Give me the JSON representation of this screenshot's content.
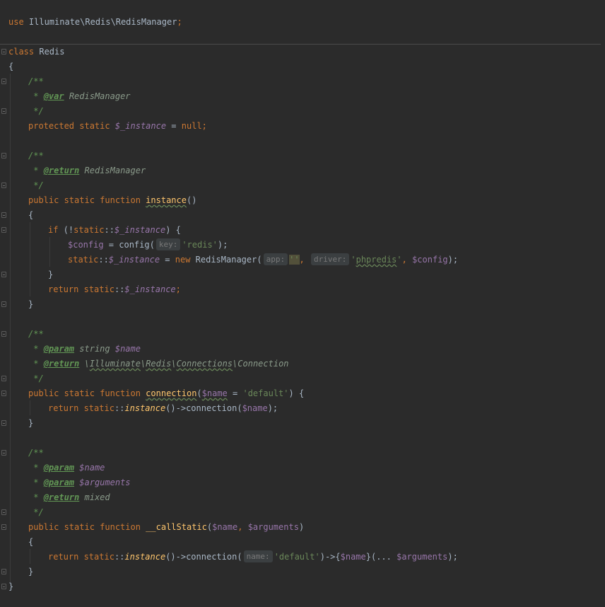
{
  "editor": {
    "use_statement": {
      "keyword": "use",
      "path": " Illuminate\\Redis\\RedisManager",
      "semicolon": ";"
    },
    "class_decl": {
      "keyword": "class",
      "name": " Redis"
    },
    "brace_open": "{",
    "brace_close": "}",
    "doc_open": "/**",
    "doc_close": " */",
    "doc_star": " * ",
    "block1": {
      "tag": "@var",
      "type": " RedisManager",
      "modifiers": "protected static ",
      "var": "$_instance",
      "assign": " = ",
      "null": "null",
      "semi": ";"
    },
    "block2": {
      "tag": "@return",
      "type": " RedisManager",
      "modifiers": "public static function ",
      "fn_name": "instance",
      "parens": "()",
      "brace_open": "{",
      "if_kw": "if",
      "if_rest1": " (!",
      "static_kw": "static",
      "double_colon": "::",
      "instance_var": "$_instance",
      "if_rest2": ") {",
      "config_var": "$config",
      "config_assign": " = config(",
      "hint_key": "key:",
      "str_redis": "'redis'",
      "config_end": ");",
      "new_kw": "new",
      "manager_call": " RedisManager(",
      "hint_app": "app:",
      "str_empty": "''",
      "comma": ", ",
      "hint_driver": "driver:",
      "str_phpredis_q1": "'",
      "str_phpredis_word": "phpredis",
      "str_phpredis_q2": "'",
      "comma2": ", ",
      "config_var2": "$config",
      "manager_end": ");",
      "close_if": "}",
      "return_kw": "return",
      "brace_close": "}"
    },
    "block3": {
      "tag1": "@param",
      "type1": " string ",
      "var1": "$name",
      "tag2": "@return",
      "type2_sep1": " \\",
      "type2_p1": "Illuminate",
      "type2_sep2": "\\",
      "type2_p2": "Redis",
      "type2_sep3": "\\",
      "type2_p3": "Connections",
      "type2_sep4": "\\",
      "type2_p4": "Connection",
      "modifiers": "public static function ",
      "fn_name": "connection",
      "paren_open": "(",
      "param_name": "$name",
      "param_eq": " = ",
      "param_default": "'default'",
      "paren_close_brace": ") {",
      "return_kw": "return",
      "static_kw": " static",
      "double_colon": "::",
      "instance_call": "instance",
      "arrow_conn": "()->connection(",
      "arg": "$name",
      "end": ");",
      "brace_close": "}"
    },
    "block4": {
      "tag1": "@param",
      "var1": " $name",
      "tag2": "@param",
      "var2": " $arguments",
      "tag3": "@return",
      "type3": " mixed",
      "modifiers": "public static function ",
      "fn_name": "__callStatic",
      "paren_open": "(",
      "param1": "$name",
      "comma": ", ",
      "param2": "$arguments",
      "paren_close": ")",
      "brace_open": "{",
      "return_kw": "return",
      "static_kw": " static",
      "double_colon": "::",
      "instance_call": "instance",
      "arrow_conn": "()->connection(",
      "hint_name": "name:",
      "str_default": "'default'",
      "dyn_call_open": ")->{",
      "dyn_var": "$name",
      "dyn_call_close": "}(... ",
      "args_var": "$arguments",
      "end": ");",
      "brace_close": "}"
    }
  }
}
